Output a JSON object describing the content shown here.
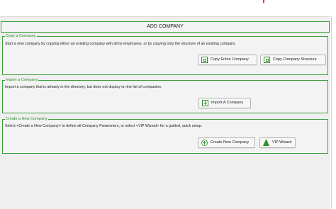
{
  "page": {
    "title": "ADD COMPANY"
  },
  "copy_section": {
    "legend": "Copy a Company",
    "description": "Start a new company by copying either an existing company with all its employees, or by copying only the structure of an existing company",
    "copy_entire_label": "Copy Entire Company",
    "copy_structure_label": "Copy Company Structure"
  },
  "import_section": {
    "legend": "Import a Company",
    "description": "Import a company that is already in the directory, but does not display on the list of companies.",
    "import_label": "Import A Company"
  },
  "create_section": {
    "legend": "Create a New Company",
    "description": "Select <Create a New Company> to define all Company Parameters, or select <VIP Wizard> for a guided, quick setup.",
    "create_label": "Create New Company",
    "wizard_label": "VIP Wizard"
  },
  "colors": {
    "accent_green": "#3aa03a",
    "panel_bg": "#efefef",
    "top_mark_red": "#e04030"
  }
}
